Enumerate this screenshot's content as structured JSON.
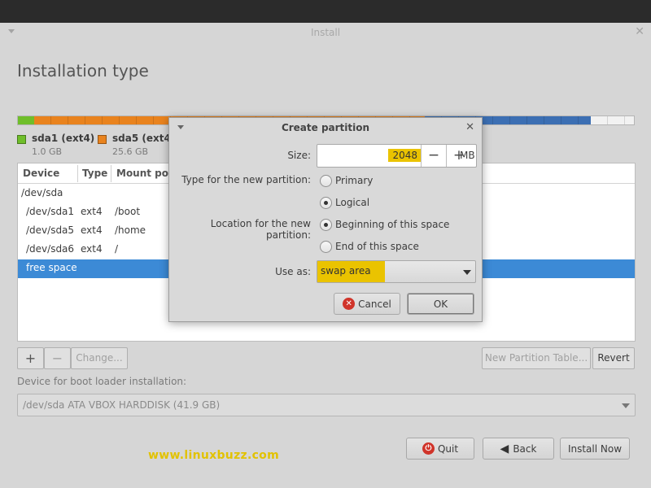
{
  "window": {
    "title": "Install"
  },
  "page": {
    "title": "Installation type"
  },
  "partition_bar": {
    "segments": [
      {
        "name": "sda1",
        "color": "#6fbe2a",
        "fraction": 0.027
      },
      {
        "name": "sda5",
        "color": "#e9831e",
        "fraction": 0.634
      },
      {
        "name": "sda6",
        "color": "#3c6fb3",
        "fraction": 0.269
      },
      {
        "name": "free",
        "color": "#f2f2f2",
        "fraction": 0.07
      }
    ]
  },
  "legend": [
    {
      "label": "sda1 (ext4)",
      "size": "1.0 GB",
      "color": "#6fbe2a"
    },
    {
      "label": "sda5 (ext4)",
      "size": "25.6 GB",
      "color": "#e9831e"
    }
  ],
  "table": {
    "headers": [
      "Device",
      "Type",
      "Mount point"
    ],
    "rows": [
      {
        "device": "/dev/sda",
        "type": "",
        "mount": ""
      },
      {
        "device": "/dev/sda1",
        "type": "ext4",
        "mount": "/boot"
      },
      {
        "device": "/dev/sda5",
        "type": "ext4",
        "mount": "/home"
      },
      {
        "device": "/dev/sda6",
        "type": "ext4",
        "mount": "/"
      },
      {
        "device": "free space",
        "type": "",
        "mount": ""
      }
    ]
  },
  "table_buttons": {
    "add": "+",
    "remove": "−",
    "change": "Change...",
    "new_table": "New Partition Table...",
    "revert": "Revert"
  },
  "boot": {
    "label": "Device for boot loader installation:",
    "value": "/dev/sda   ATA VBOX HARDDISK (41.9 GB)"
  },
  "footer": {
    "quit": "Quit",
    "back": "Back",
    "install": "Install Now",
    "watermark": "www.linuxbuzz.com"
  },
  "dialog": {
    "title": "Create partition",
    "size_label": "Size:",
    "size_value": "2048",
    "size_unit": "MB",
    "minus": "−",
    "plus": "+",
    "type_label": "Type for the new partition:",
    "type_options": [
      "Primary",
      "Logical"
    ],
    "type_selected": "Logical",
    "location_label": "Location for the new partition:",
    "location_options": [
      "Beginning of this space",
      "End of this space"
    ],
    "location_selected": "Beginning of this space",
    "use_label": "Use as:",
    "use_value": "swap area",
    "cancel": "Cancel",
    "ok": "OK"
  }
}
